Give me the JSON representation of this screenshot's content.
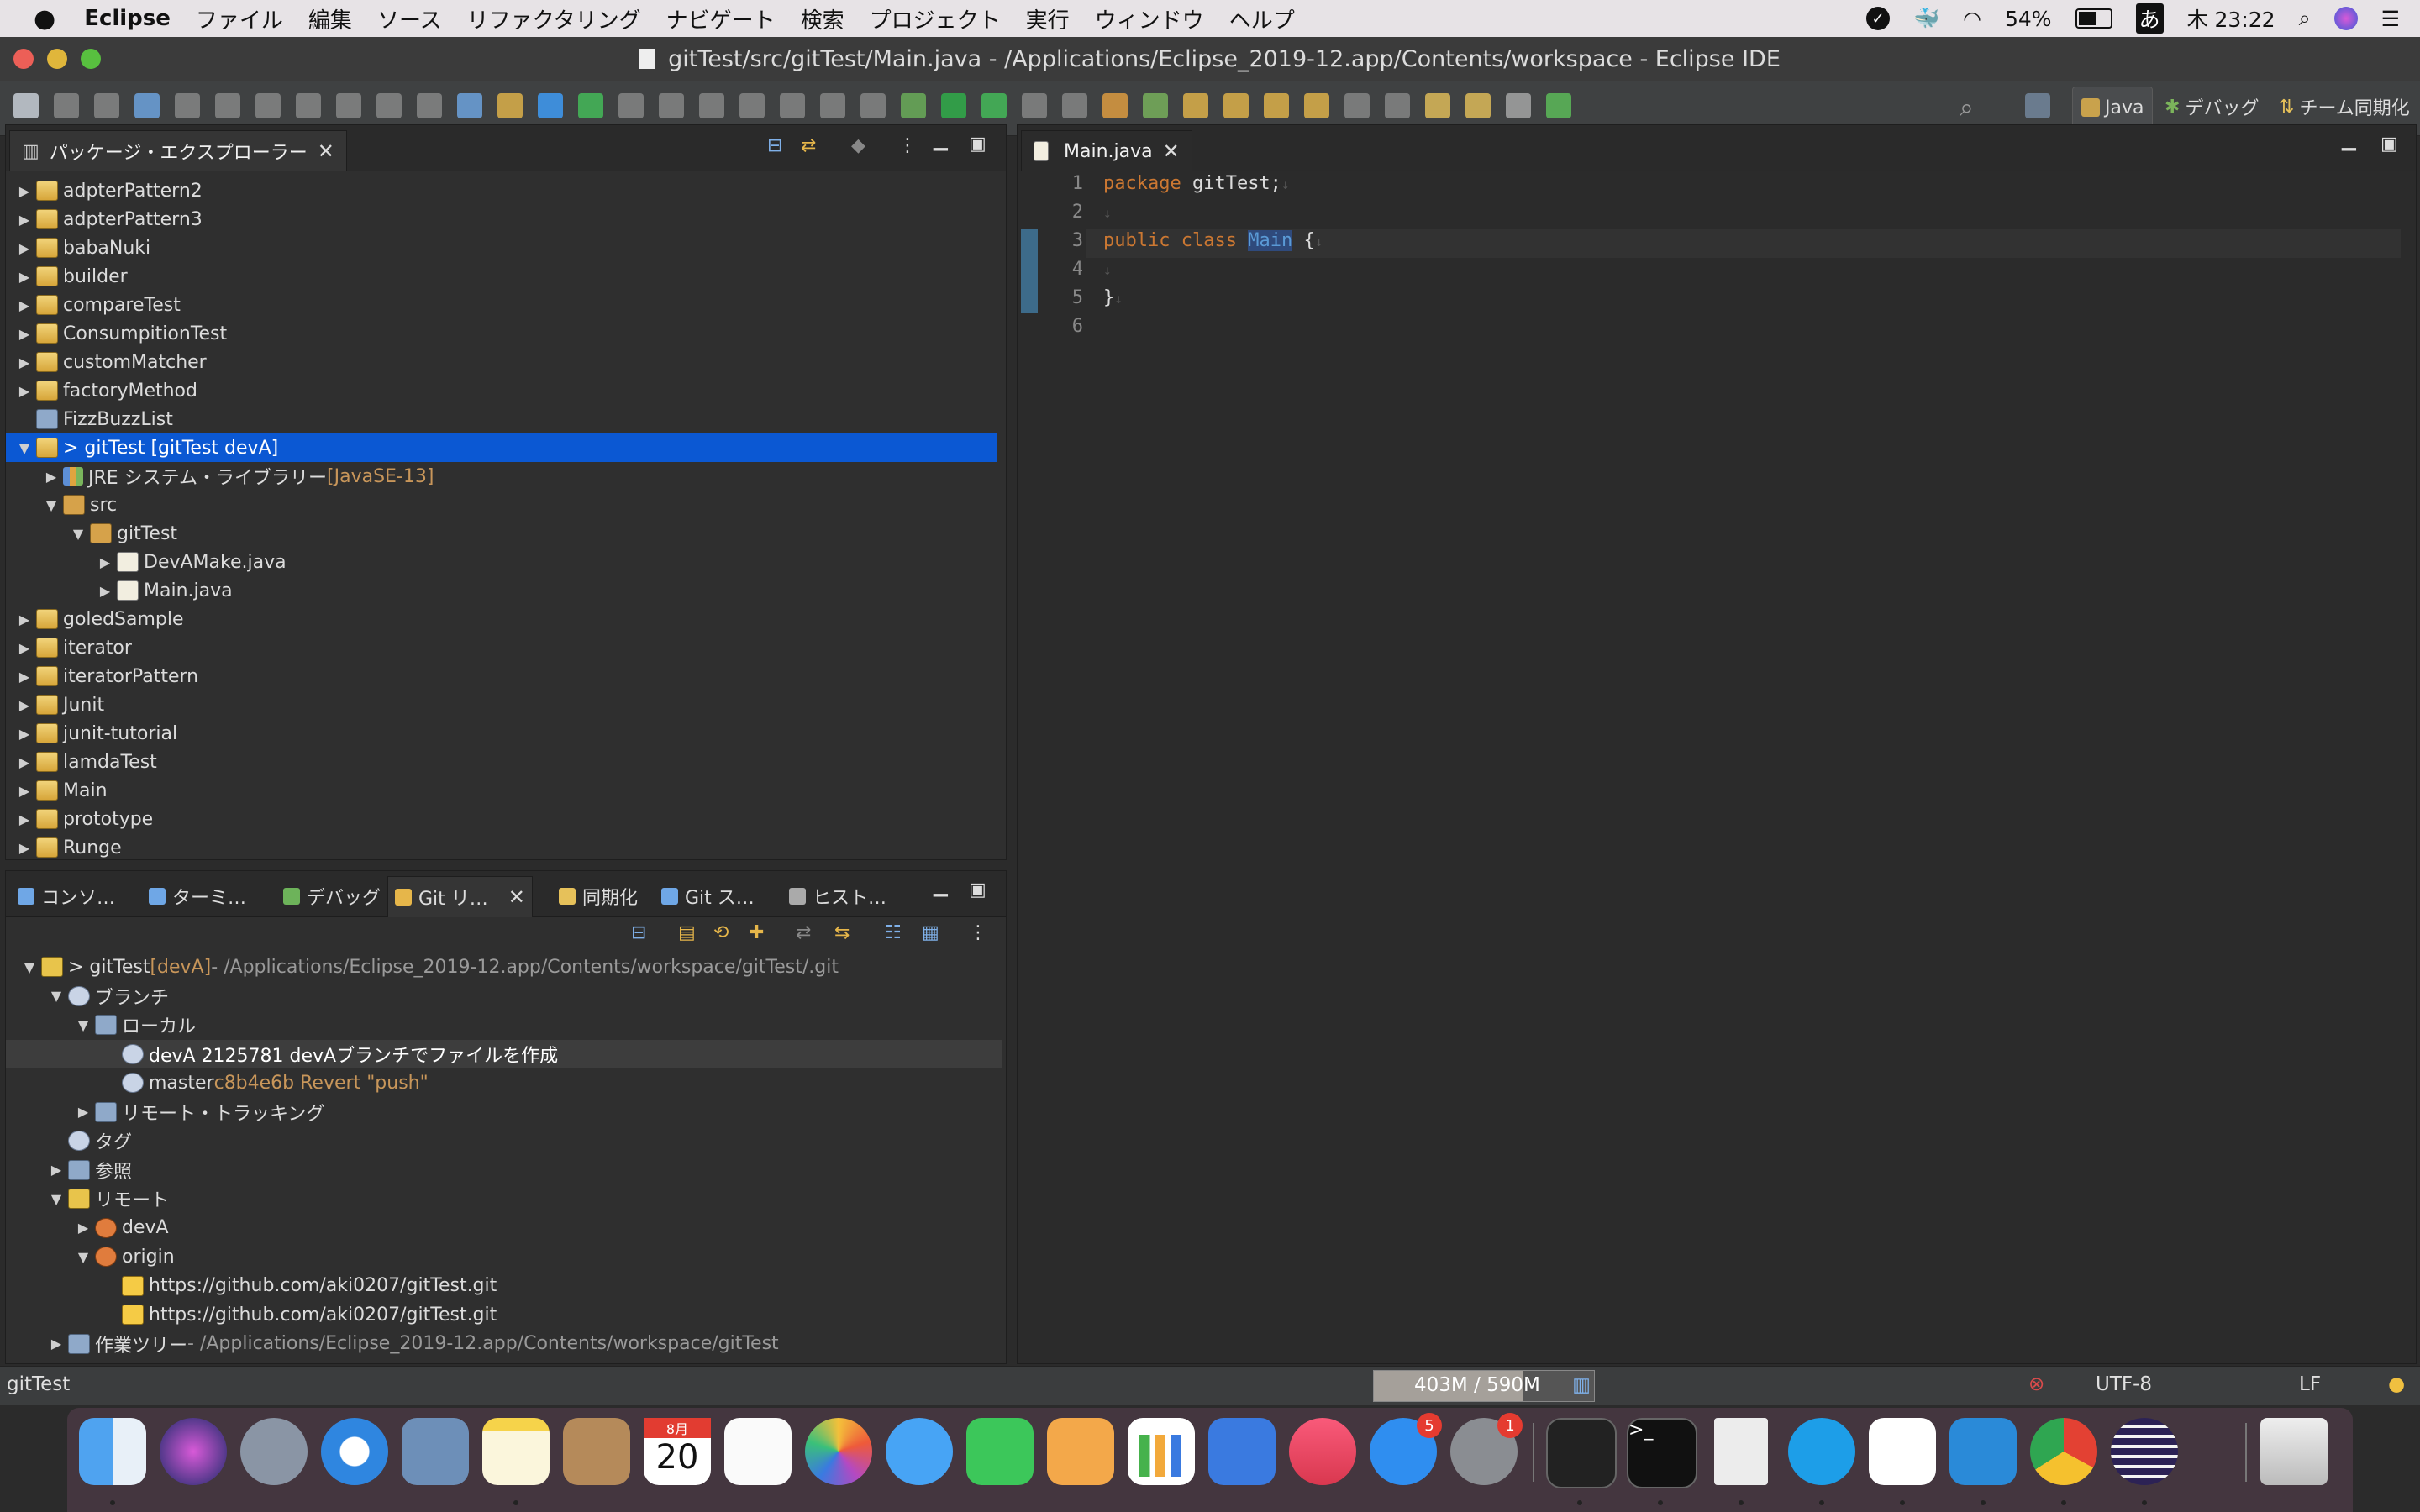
{
  "menubar": {
    "app_name": "Eclipse",
    "items": [
      "ファイル",
      "編集",
      "ソース",
      "リファクタリング",
      "ナビゲート",
      "検索",
      "プロジェクト",
      "実行",
      "ウィンドウ",
      "ヘルプ"
    ],
    "battery": "54%",
    "input_method": "あ",
    "clock": "木 23:22"
  },
  "window": {
    "title": "gitTest/src/gitTest/Main.java - /Applications/Eclipse_2019-12.app/Contents/workspace - Eclipse IDE"
  },
  "perspectives": {
    "java": "Java",
    "debug": "デバッグ",
    "team_sync": "チーム同期化"
  },
  "package_explorer": {
    "tab_title": "パッケージ・エクスプローラー",
    "items": [
      {
        "label": "adpterPattern2",
        "suffix": "",
        "level": 0,
        "expanded": false,
        "icon": "project"
      },
      {
        "label": "adpterPattern3",
        "suffix": "",
        "level": 0,
        "expanded": false,
        "icon": "project"
      },
      {
        "label": "babaNuki",
        "suffix": "",
        "level": 0,
        "expanded": false,
        "icon": "project"
      },
      {
        "label": "builder",
        "suffix": "",
        "level": 0,
        "expanded": false,
        "icon": "project"
      },
      {
        "label": "compareTest",
        "suffix": "",
        "level": 0,
        "expanded": false,
        "icon": "project"
      },
      {
        "label": "ConsumpitionTest",
        "suffix": "",
        "level": 0,
        "expanded": false,
        "icon": "project"
      },
      {
        "label": "customMatcher",
        "suffix": "",
        "level": 0,
        "expanded": false,
        "icon": "project"
      },
      {
        "label": "factoryMethod",
        "suffix": "",
        "level": 0,
        "expanded": false,
        "icon": "project"
      },
      {
        "label": "FizzBuzzList",
        "suffix": "",
        "level": 0,
        "expanded": null,
        "icon": "folder"
      },
      {
        "label": "> gitTest [gitTest devA]",
        "suffix": "",
        "level": 0,
        "expanded": true,
        "icon": "project",
        "selected": true
      },
      {
        "label": "JRE システム・ライブラリー",
        "suffix": " [JavaSE-13]",
        "level": 1,
        "expanded": false,
        "icon": "library"
      },
      {
        "label": "src",
        "suffix": "",
        "level": 1,
        "expanded": true,
        "icon": "package"
      },
      {
        "label": "gitTest",
        "suffix": "",
        "level": 2,
        "expanded": true,
        "icon": "package"
      },
      {
        "label": "DevAMake.java",
        "suffix": "",
        "level": 3,
        "expanded": false,
        "icon": "java"
      },
      {
        "label": "Main.java",
        "suffix": "",
        "level": 3,
        "expanded": false,
        "icon": "java"
      },
      {
        "label": "goledSample",
        "suffix": "",
        "level": 0,
        "expanded": false,
        "icon": "project"
      },
      {
        "label": "iterator",
        "suffix": "",
        "level": 0,
        "expanded": false,
        "icon": "project"
      },
      {
        "label": "iteratorPattern",
        "suffix": "",
        "level": 0,
        "expanded": false,
        "icon": "project"
      },
      {
        "label": "Junit",
        "suffix": "",
        "level": 0,
        "expanded": false,
        "icon": "project"
      },
      {
        "label": "junit-tutorial",
        "suffix": "",
        "level": 0,
        "expanded": false,
        "icon": "project"
      },
      {
        "label": "lamdaTest",
        "suffix": "",
        "level": 0,
        "expanded": false,
        "icon": "project"
      },
      {
        "label": "Main",
        "suffix": "",
        "level": 0,
        "expanded": false,
        "icon": "project"
      },
      {
        "label": "prototype",
        "suffix": "",
        "level": 0,
        "expanded": false,
        "icon": "project"
      },
      {
        "label": "Runge",
        "suffix": "",
        "level": 0,
        "expanded": false,
        "icon": "project"
      }
    ]
  },
  "bottom_tabs": [
    "コンソ…",
    "ターミ…",
    "デバッグ",
    "Git リ…",
    "同期化",
    "Git ス…",
    "ヒスト…"
  ],
  "git_repos": {
    "items": [
      {
        "label": "> gitTest",
        "tag": " [devA]",
        "dim": " - /Applications/Eclipse_2019-12.app/Contents/workspace/gitTest/.git",
        "level": 0,
        "expanded": true,
        "icon": "git"
      },
      {
        "label": "ブランチ",
        "tag": "",
        "dim": "",
        "level": 1,
        "expanded": true,
        "icon": "branch"
      },
      {
        "label": "ローカル",
        "tag": "",
        "dim": "",
        "level": 2,
        "expanded": true,
        "icon": "folder"
      },
      {
        "label": "devA 2125781 devAブランチでファイルを作成",
        "tag": "",
        "dim": "",
        "level": 3,
        "expanded": null,
        "icon": "branch",
        "highlight": true
      },
      {
        "label": "master",
        "tag": " c8b4e6b Revert \"push\"",
        "dim": "",
        "level": 3,
        "expanded": null,
        "icon": "branch"
      },
      {
        "label": "リモート・トラッキング",
        "tag": "",
        "dim": "",
        "level": 2,
        "expanded": false,
        "icon": "folder"
      },
      {
        "label": "タグ",
        "tag": "",
        "dim": "",
        "level": 1,
        "expanded": null,
        "icon": "branch"
      },
      {
        "label": "参照",
        "tag": "",
        "dim": "",
        "level": 1,
        "expanded": false,
        "icon": "folder"
      },
      {
        "label": "リモート",
        "tag": "",
        "dim": "",
        "level": 1,
        "expanded": true,
        "icon": "git"
      },
      {
        "label": "devA",
        "tag": "",
        "dim": "",
        "level": 2,
        "expanded": false,
        "icon": "remote"
      },
      {
        "label": "origin",
        "tag": "",
        "dim": "",
        "level": 2,
        "expanded": true,
        "icon": "remote"
      },
      {
        "label": "https://github.com/aki0207/gitTest.git",
        "tag": "",
        "dim": "",
        "level": 3,
        "expanded": null,
        "icon": "url"
      },
      {
        "label": "https://github.com/aki0207/gitTest.git",
        "tag": "",
        "dim": "",
        "level": 3,
        "expanded": null,
        "icon": "url"
      },
      {
        "label": "作業ツリー",
        "tag": "",
        "dim": " - /Applications/Eclipse_2019-12.app/Contents/workspace/gitTest",
        "level": 1,
        "expanded": false,
        "icon": "folder"
      }
    ]
  },
  "editor": {
    "tab_title": "Main.java",
    "lines": [
      {
        "num": "1",
        "tokens": [
          {
            "t": "package",
            "c": "kw"
          },
          {
            "t": " gitTest;",
            "c": ""
          },
          {
            "t": "↓",
            "c": "ws"
          }
        ]
      },
      {
        "num": "2",
        "tokens": [
          {
            "t": "↓",
            "c": "ws"
          }
        ]
      },
      {
        "num": "3",
        "tokens": [
          {
            "t": "public",
            "c": "kw"
          },
          {
            "t": " ",
            "c": ""
          },
          {
            "t": "class",
            "c": "kw"
          },
          {
            "t": " ",
            "c": ""
          },
          {
            "t": "Main",
            "c": "cls"
          },
          {
            "t": " {",
            "c": ""
          },
          {
            "t": "↓",
            "c": "ws"
          }
        ],
        "current": true
      },
      {
        "num": "4",
        "tokens": [
          {
            "t": "↓",
            "c": "ws"
          }
        ]
      },
      {
        "num": "5",
        "tokens": [
          {
            "t": "}",
            "c": ""
          },
          {
            "t": "↓",
            "c": "ws"
          }
        ]
      },
      {
        "num": "6",
        "tokens": []
      }
    ]
  },
  "statusbar": {
    "left": "gitTest",
    "heap": "403M / 590M",
    "heap_used_fraction": 0.68,
    "encoding": "UTF-8",
    "line_delimiter": "LF"
  },
  "dock": {
    "calendar_month": "8月",
    "calendar_day": "20",
    "appstore_badge": "5",
    "settings_badge": "1"
  }
}
